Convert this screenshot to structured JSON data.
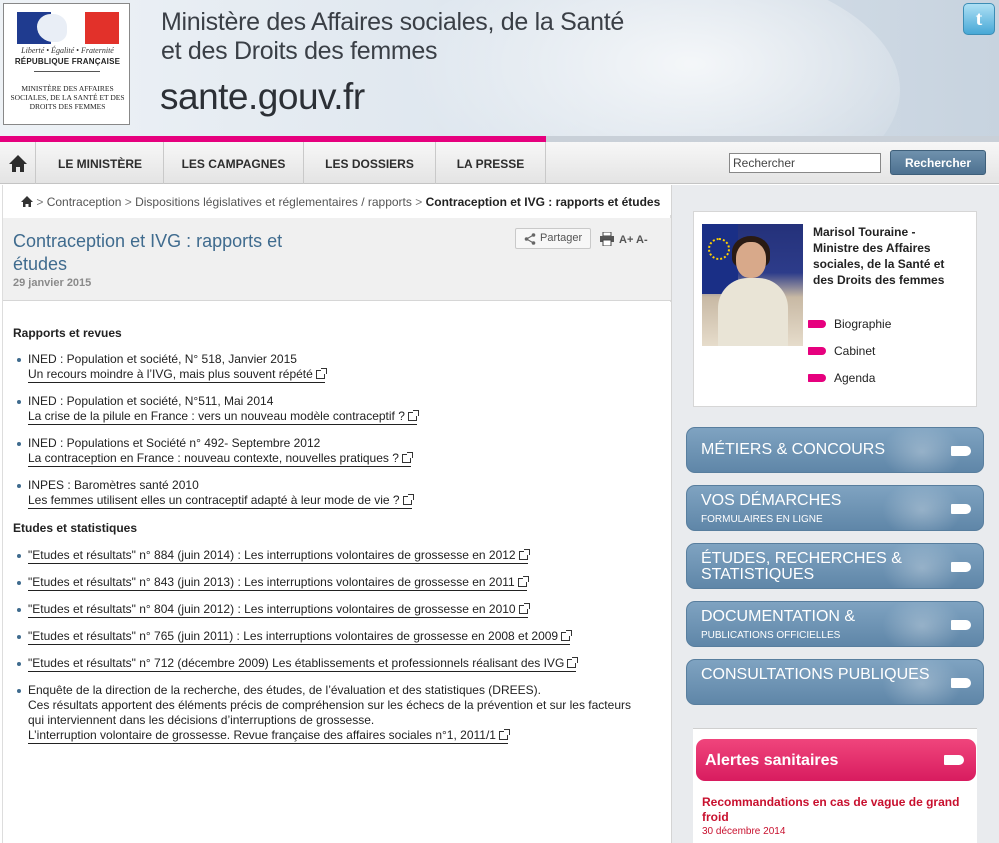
{
  "header": {
    "logo": {
      "motto": "Liberté • Égalité • Fraternité",
      "republic": "RÉPUBLIQUE FRANÇAISE",
      "ministry": "MINISTÈRE DES AFFAIRES SOCIALES, DE LA SANTÉ ET DES DROITS DES FEMMES"
    },
    "ministry_title_line1": "Ministère des Affaires sociales, de la Santé",
    "ministry_title_line2": "et des Droits des femmes",
    "site_name": "sante.gouv.fr",
    "twitter_icon": "twitter-icon"
  },
  "nav": {
    "items": [
      {
        "label": "LE MINISTÈRE"
      },
      {
        "label": "LES CAMPAGNES"
      },
      {
        "label": "LES DOSSIERS"
      },
      {
        "label": "LA PRESSE"
      }
    ],
    "search_placeholder": "Rechercher",
    "search_value": "Rechercher",
    "search_button": "Rechercher"
  },
  "breadcrumb": {
    "items": [
      "Contraception",
      "Dispositions législatives et réglementaires / rapports"
    ],
    "current": "Contraception et IVG : rapports et études"
  },
  "page": {
    "title_line1": "Contraception et IVG : rapports et",
    "title_line2": "études",
    "date": "29 janvier 2015",
    "share": "Partager",
    "font_tools": "A+ A-"
  },
  "content": {
    "section1": "Rapports et revues",
    "reports": [
      {
        "source": "INED : Population et société, N° 518, Janvier 2015",
        "link": "Un recours moindre à l’IVG, mais plus souvent répété"
      },
      {
        "source": "INED : Population et société, N°511, Mai 2014",
        "link": "La crise de la pilule en France : vers un nouveau modèle contraceptif ?"
      },
      {
        "source": "INED : Populations et Société n° 492- Septembre 2012",
        "link": "La contraception en France : nouveau contexte, nouvelles pratiques ?"
      },
      {
        "source": "INPES : Baromètres santé 2010",
        "link": "Les femmes utilisent elles un contraceptif adapté à leur mode de vie ?"
      }
    ],
    "section2": "Etudes et statistiques",
    "studies": [
      "\"Etudes et résultats\" n° 884 (juin 2014) : Les interruptions volontaires de grossesse en 2012",
      "\"Etudes et résultats\" n° 843 (juin 2013) : Les interruptions volontaires de grossesse en 2011",
      "\"Etudes et résultats\" n° 804 (juin 2012) : Les interruptions volontaires de grossesse en 2010",
      "\"Etudes et résultats\" n° 765 (juin 2011) : Les interruptions volontaires de grossesse en 2008 et 2009",
      "\"Etudes et résultats\" n° 712 (décembre 2009) Les établissements et professionnels réalisant des IVG"
    ],
    "drees": {
      "line1": "Enquête de la direction de la recherche, des études, de l’évaluation et des statistiques (DREES).",
      "line2": "Ces résultats apportent des éléments précis de compréhension sur les échecs de la prévention et sur les facteurs",
      "line3": "qui interviennent dans les décisions d’interruptions de grossesse.",
      "link": "L’interruption volontaire de grossesse. Revue française des affaires sociales n°1, 2011/1"
    }
  },
  "sidebar": {
    "minister": {
      "name": "Marisol Touraine - Ministre des Affaires sociales, de la Santé et des Droits des femmes",
      "links": [
        "Biographie",
        "Cabinet",
        "Agenda"
      ]
    },
    "blocks": [
      {
        "big": "MÉTIERS & CONCOURS",
        "small": ""
      },
      {
        "big": "VOS DÉMARCHES",
        "small": "FORMULAIRES EN LIGNE"
      },
      {
        "big": "ÉTUDES, RECHERCHES & STATISTIQUES",
        "small": ""
      },
      {
        "big": "DOCUMENTATION &",
        "small": "PUBLICATIONS OFFICIELLES"
      },
      {
        "big": "CONSULTATIONS PUBLIQUES",
        "small": ""
      }
    ],
    "alerts": {
      "title": "Alertes sanitaires",
      "item_title": "Recommandations en cas de vague de grand froid",
      "item_date": "30 décembre 2014"
    }
  },
  "colors": {
    "accent_pink": "#e6007e",
    "title_blue": "#3f6b8e",
    "button_blue": "#6f91ad",
    "alert_red": "#c8102e"
  }
}
